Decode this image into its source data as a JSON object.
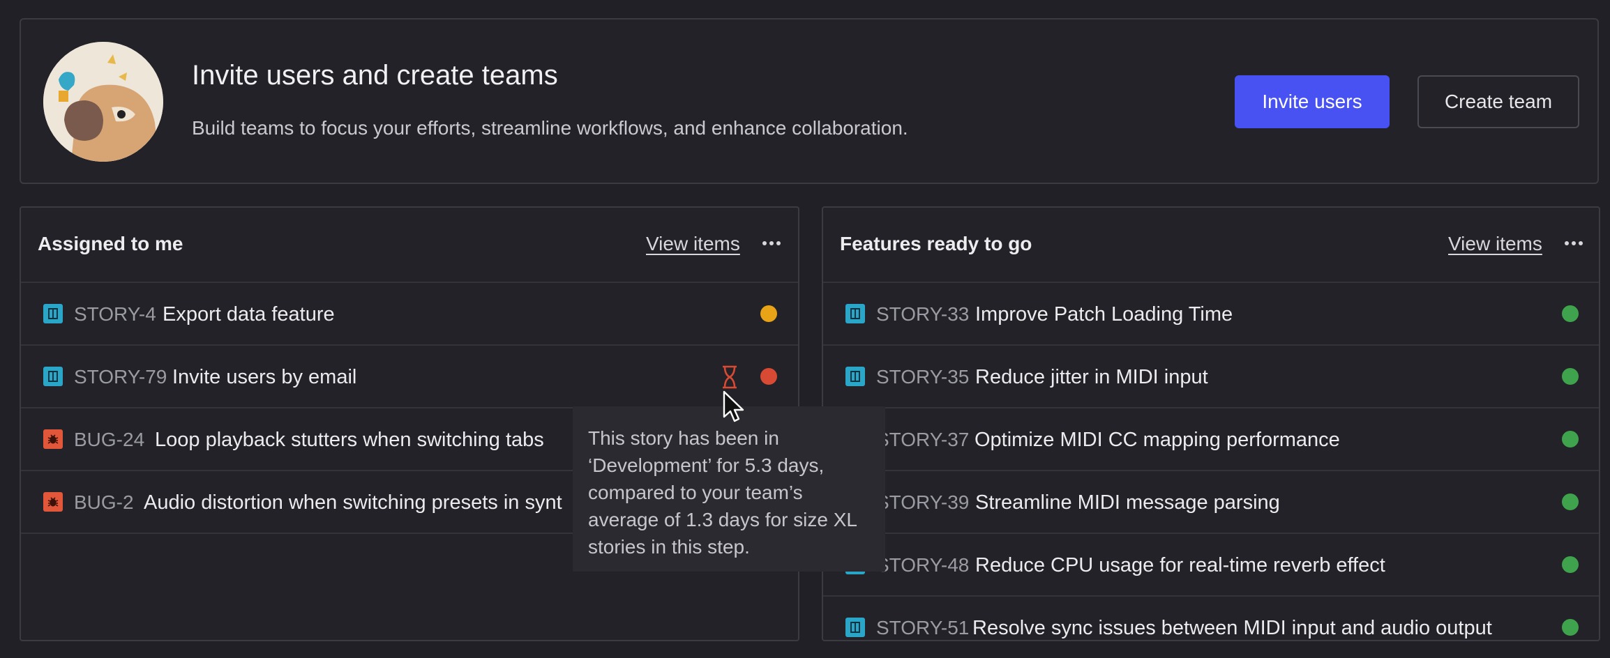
{
  "invite": {
    "title": "Invite users and create teams",
    "subtitle": "Build teams to focus your efforts, streamline workflows, and enhance collaboration.",
    "invite_button": "Invite users",
    "create_team_button": "Create team"
  },
  "assigned": {
    "title": "Assigned to me",
    "view_label": "View items",
    "items": [
      {
        "type": "story",
        "key": "STORY-4",
        "title": "Export data feature",
        "status_color": "#e8a317"
      },
      {
        "type": "story",
        "key": "STORY-79",
        "title": "Invite users by email",
        "status_color": "#d94a35",
        "icon": "hourglass-icon"
      },
      {
        "type": "bug",
        "key": "BUG-24",
        "title": "Loop playback stutters when switching tabs"
      },
      {
        "type": "bug",
        "key": "BUG-2",
        "title": "Audio distortion when switching presets in synt"
      }
    ]
  },
  "features": {
    "title": "Features ready to go",
    "view_label": "View items",
    "items": [
      {
        "type": "story",
        "key": "STORY-33",
        "title": "Improve Patch Loading Time",
        "status_color": "#3fa34d"
      },
      {
        "type": "story",
        "key": "STORY-35",
        "title": "Reduce jitter in MIDI input",
        "status_color": "#3fa34d"
      },
      {
        "type": "story",
        "key": "STORY-37",
        "title": "Optimize MIDI CC mapping performance",
        "status_color": "#3fa34d"
      },
      {
        "type": "story",
        "key": "STORY-39",
        "title": "Streamline MIDI message parsing",
        "status_color": "#3fa34d"
      },
      {
        "type": "story",
        "key": "STORY-48",
        "title": "Reduce CPU usage for real-time reverb effect",
        "status_color": "#3fa34d"
      },
      {
        "type": "story",
        "key": "STORY-51",
        "title": "Resolve sync issues between MIDI input and audio output",
        "status_color": "#3fa34d"
      }
    ]
  },
  "tooltip": {
    "text": "This story has been in ‘Development’ for 5.3 days, compared to your team’s average of 1.3 days for size XL stories in this step."
  }
}
